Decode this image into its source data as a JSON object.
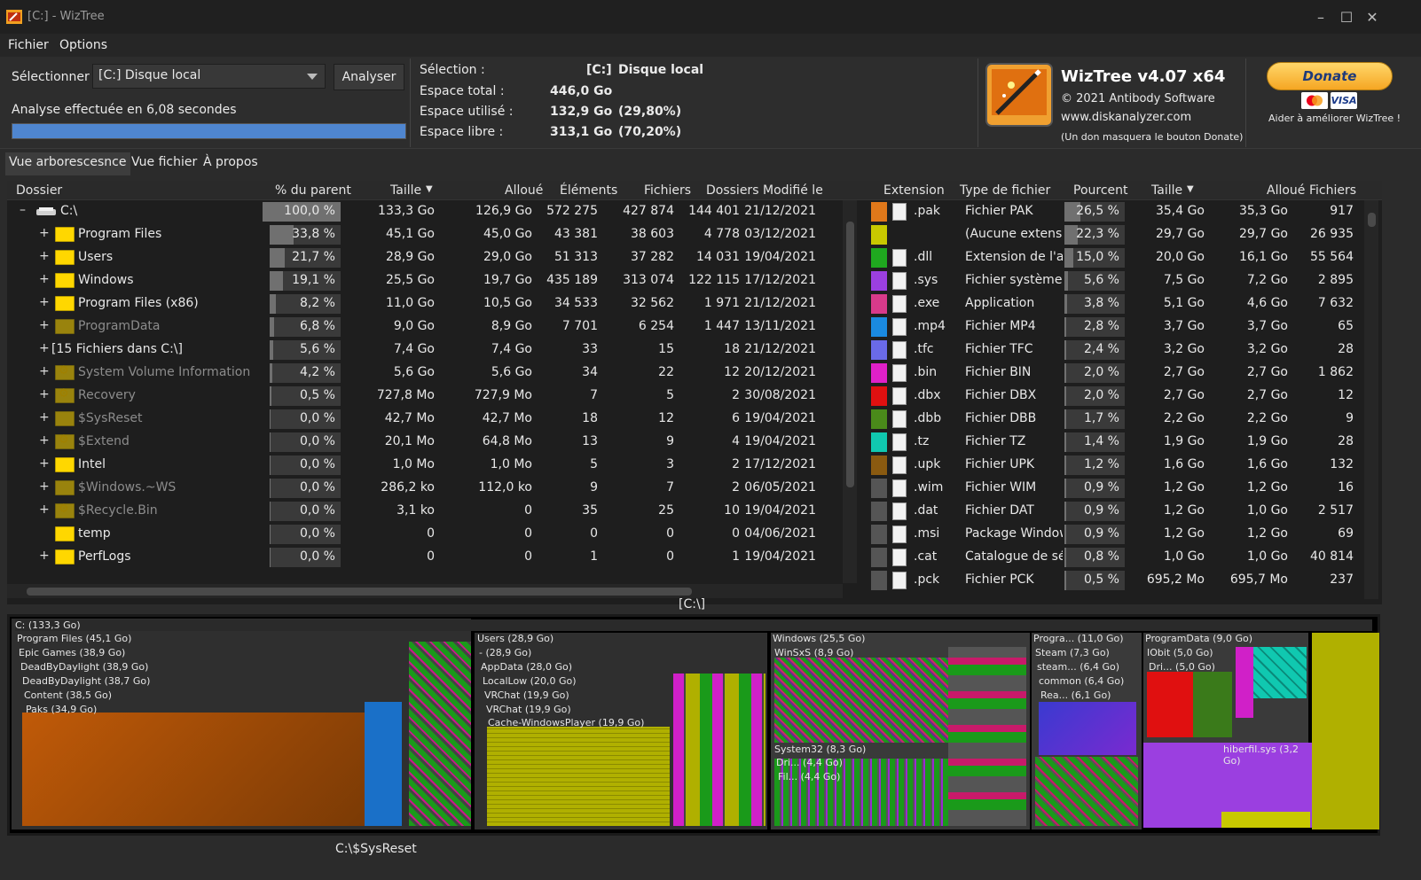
{
  "window": {
    "title": "[C:]  - WizTree",
    "controls": [
      "–",
      "☐",
      "✕"
    ]
  },
  "menu": {
    "file": "Fichier",
    "options": "Options"
  },
  "select_label": "Sélectionner :",
  "drive_value": "[C:] Disque local",
  "analyze_label": "Analyser",
  "analysis_time": "Analyse effectuée en 6,08 secondes",
  "progress": 1.0,
  "selection": {
    "label": "Sélection :",
    "drive": "[C:]",
    "name": "Disque local",
    "total_label": "Espace total :",
    "total": "446,0 Go",
    "used_label": "Espace utilisé :",
    "used": "132,9 Go",
    "used_pct": "(29,80%)",
    "free_label": "Espace libre :",
    "free": "313,1 Go",
    "free_pct": "(70,20%)"
  },
  "about": {
    "name": "WizTree v4.07 x64",
    "copyright": "© 2021 Antibody Software",
    "site": "www.diskanalyzer.com",
    "note": "(Un don masquera le bouton Donate)"
  },
  "donate": {
    "label": "Donate",
    "visa": "VISA",
    "caption": "Aider à améliorer WizTree !"
  },
  "tabs": [
    "Vue arborescesnce",
    "Vue fichier",
    "À propos"
  ],
  "tree": {
    "headers": [
      "Dossier",
      "% du parent",
      "Taille",
      "Alloué",
      "Éléments",
      "Fichiers",
      "Dossiers",
      "Modifié le"
    ],
    "rows": [
      {
        "name": "C:\\",
        "pct": "100,0 %",
        "pctv": 100,
        "size": "133,3 Go",
        "alloc": "126,9 Go",
        "items": "572 275",
        "files": "427 874",
        "dirs": "144 401",
        "date": "21/12/2021",
        "type": "drive",
        "exp": "–"
      },
      {
        "name": "Program Files",
        "pct": "33,8 %",
        "pctv": 33.8,
        "size": "45,1 Go",
        "alloc": "45,0 Go",
        "items": "43 381",
        "files": "38 603",
        "dirs": "4 778",
        "date": "03/12/2021",
        "type": "folder",
        "exp": "+"
      },
      {
        "name": "Users",
        "pct": "21,7 %",
        "pctv": 21.7,
        "size": "28,9 Go",
        "alloc": "29,0 Go",
        "items": "51 313",
        "files": "37 282",
        "dirs": "14 031",
        "date": "19/04/2021",
        "type": "folder",
        "exp": "+"
      },
      {
        "name": "Windows",
        "pct": "19,1 %",
        "pctv": 19.1,
        "size": "25,5 Go",
        "alloc": "19,7 Go",
        "items": "435 189",
        "files": "313 074",
        "dirs": "122 115",
        "date": "17/12/2021",
        "type": "folder",
        "exp": "+"
      },
      {
        "name": "Program Files (x86)",
        "pct": "8,2 %",
        "pctv": 8.2,
        "size": "11,0 Go",
        "alloc": "10,5 Go",
        "items": "34 533",
        "files": "32 562",
        "dirs": "1 971",
        "date": "21/12/2021",
        "type": "folder",
        "exp": "+"
      },
      {
        "name": "ProgramData",
        "pct": "6,8 %",
        "pctv": 6.8,
        "size": "9,0 Go",
        "alloc": "8,9 Go",
        "items": "7 701",
        "files": "6 254",
        "dirs": "1 447",
        "date": "13/11/2021",
        "type": "folder-gray",
        "exp": "+"
      },
      {
        "name": "[15 Fichiers dans C:\\]",
        "pct": "5,6 %",
        "pctv": 5.6,
        "size": "7,4 Go",
        "alloc": "7,4 Go",
        "items": "33",
        "files": "15",
        "dirs": "18",
        "date": "21/12/2021",
        "type": "none",
        "exp": "+"
      },
      {
        "name": "System Volume Information",
        "pct": "4,2 %",
        "pctv": 4.2,
        "size": "5,6 Go",
        "alloc": "5,6 Go",
        "items": "34",
        "files": "22",
        "dirs": "12",
        "date": "20/12/2021",
        "type": "sys",
        "exp": "+"
      },
      {
        "name": "Recovery",
        "pct": "0,5 %",
        "pctv": 0.5,
        "size": "727,8 Mo",
        "alloc": "727,9 Mo",
        "items": "7",
        "files": "5",
        "dirs": "2",
        "date": "30/08/2021",
        "type": "sys",
        "exp": "+"
      },
      {
        "name": "$SysReset",
        "pct": "0,0 %",
        "pctv": 0,
        "size": "42,7 Mo",
        "alloc": "42,7 Mo",
        "items": "18",
        "files": "12",
        "dirs": "6",
        "date": "19/04/2021",
        "type": "folder-gray",
        "exp": "+"
      },
      {
        "name": "$Extend",
        "pct": "0,0 %",
        "pctv": 0,
        "size": "20,1 Mo",
        "alloc": "64,8 Mo",
        "items": "13",
        "files": "9",
        "dirs": "4",
        "date": "19/04/2021",
        "type": "sys",
        "exp": "+"
      },
      {
        "name": "Intel",
        "pct": "0,0 %",
        "pctv": 0,
        "size": "1,0 Mo",
        "alloc": "1,0 Mo",
        "items": "5",
        "files": "3",
        "dirs": "2",
        "date": "17/12/2021",
        "type": "folder",
        "exp": "+"
      },
      {
        "name": "$Windows.~WS",
        "pct": "0,0 %",
        "pctv": 0,
        "size": "286,2 ko",
        "alloc": "112,0 ko",
        "items": "9",
        "files": "7",
        "dirs": "2",
        "date": "06/05/2021",
        "type": "folder-gray",
        "exp": "+"
      },
      {
        "name": "$Recycle.Bin",
        "pct": "0,0 %",
        "pctv": 0,
        "size": "3,1 ko",
        "alloc": "0",
        "items": "35",
        "files": "25",
        "dirs": "10",
        "date": "19/04/2021",
        "type": "sys",
        "exp": "+"
      },
      {
        "name": "temp",
        "pct": "0,0 %",
        "pctv": 0,
        "size": "0",
        "alloc": "0",
        "items": "0",
        "files": "0",
        "dirs": "0",
        "date": "04/06/2021",
        "type": "folder",
        "exp": ""
      },
      {
        "name": "PerfLogs",
        "pct": "0,0 %",
        "pctv": 0,
        "size": "0",
        "alloc": "0",
        "items": "1",
        "files": "0",
        "dirs": "1",
        "date": "19/04/2021",
        "type": "folder",
        "exp": "+"
      }
    ]
  },
  "ext": {
    "headers": [
      "Extension",
      "Type de fichier",
      "Pourcent",
      "Taille",
      "Alloué",
      "Fichiers"
    ],
    "rows": [
      {
        "color": "#e0781a",
        "ext": ".pak",
        "type": "Fichier PAK",
        "pct": "26,5 %",
        "pctv": 26.5,
        "size": "35,4 Go",
        "alloc": "35,3 Go",
        "files": "917"
      },
      {
        "color": "#c8c800",
        "ext": "",
        "type": "(Aucune extensio",
        "pct": "22,3 %",
        "pctv": 22.3,
        "size": "29,7 Go",
        "alloc": "29,7 Go",
        "files": "26 935"
      },
      {
        "color": "#1fa81f",
        "ext": ".dll",
        "type": "Extension de l'ap",
        "pct": "15,0 %",
        "pctv": 15,
        "size": "20,0 Go",
        "alloc": "16,1 Go",
        "files": "55 564"
      },
      {
        "color": "#9b3fe0",
        "ext": ".sys",
        "type": "Fichier système",
        "pct": "5,6 %",
        "pctv": 5.6,
        "size": "7,5 Go",
        "alloc": "7,2 Go",
        "files": "2 895"
      },
      {
        "color": "#d83a8a",
        "ext": ".exe",
        "type": "Application",
        "pct": "3,8 %",
        "pctv": 3.8,
        "size": "5,1 Go",
        "alloc": "4,6 Go",
        "files": "7 632"
      },
      {
        "color": "#1a8ae0",
        "ext": ".mp4",
        "type": "Fichier MP4",
        "pct": "2,8 %",
        "pctv": 2.8,
        "size": "3,7 Go",
        "alloc": "3,7 Go",
        "files": "65"
      },
      {
        "color": "#6a6ae8",
        "ext": ".tfc",
        "type": "Fichier TFC",
        "pct": "2,4 %",
        "pctv": 2.4,
        "size": "3,2 Go",
        "alloc": "3,2 Go",
        "files": "28"
      },
      {
        "color": "#e020c8",
        "ext": ".bin",
        "type": "Fichier BIN",
        "pct": "2,0 %",
        "pctv": 2,
        "size": "2,7 Go",
        "alloc": "2,7 Go",
        "files": "1 862"
      },
      {
        "color": "#e01010",
        "ext": ".dbx",
        "type": "Fichier DBX",
        "pct": "2,0 %",
        "pctv": 2,
        "size": "2,7 Go",
        "alloc": "2,7 Go",
        "files": "12"
      },
      {
        "color": "#4a8a1a",
        "ext": ".dbb",
        "type": "Fichier DBB",
        "pct": "1,7 %",
        "pctv": 1.7,
        "size": "2,2 Go",
        "alloc": "2,2 Go",
        "files": "9"
      },
      {
        "color": "#10c8b0",
        "ext": ".tz",
        "type": "Fichier TZ",
        "pct": "1,4 %",
        "pctv": 1.4,
        "size": "1,9 Go",
        "alloc": "1,9 Go",
        "files": "28"
      },
      {
        "color": "#8a5a10",
        "ext": ".upk",
        "type": "Fichier UPK",
        "pct": "1,2 %",
        "pctv": 1.2,
        "size": "1,6 Go",
        "alloc": "1,6 Go",
        "files": "132"
      },
      {
        "color": "#555555",
        "ext": ".wim",
        "type": "Fichier WIM",
        "pct": "0,9 %",
        "pctv": 0.9,
        "size": "1,2 Go",
        "alloc": "1,2 Go",
        "files": "16"
      },
      {
        "color": "#555555",
        "ext": ".dat",
        "type": "Fichier DAT",
        "pct": "0,9 %",
        "pctv": 0.9,
        "size": "1,2 Go",
        "alloc": "1,0 Go",
        "files": "2 517"
      },
      {
        "color": "#555555",
        "ext": ".msi",
        "type": "Package Window",
        "pct": "0,9 %",
        "pctv": 0.9,
        "size": "1,2 Go",
        "alloc": "1,2 Go",
        "files": "69"
      },
      {
        "color": "#555555",
        "ext": ".cat",
        "type": "Catalogue de sé",
        "pct": "0,8 %",
        "pctv": 0.8,
        "size": "1,0 Go",
        "alloc": "1,0 Go",
        "files": "40 814"
      },
      {
        "color": "#555555",
        "ext": ".pck",
        "type": "Fichier PCK",
        "pct": "0,5 %",
        "pctv": 0.5,
        "size": "695,2 Mo",
        "alloc": "695,7 Mo",
        "files": "237"
      }
    ]
  },
  "path_label": "[C:\\]",
  "treemap_labels": {
    "root": "C: (133,3 Go)",
    "pf": "Program Files (45,1 Go)",
    "epic": "Epic Games (38,9 Go)",
    "dbd1": "DeadByDaylight (38,9 Go)",
    "dbd2": "DeadByDaylight (38,7 Go)",
    "content": "Content (38,5 Go)",
    "paks": "Paks (34,9 Go)",
    "users": "Users (28,9 Go)",
    "dash": "- (28,9 Go)",
    "appdata": "AppData (28,0 Go)",
    "locallow": "LocalLow (20,0 Go)",
    "vrchat1": "VRChat (19,9 Go)",
    "vrchat2": "VRChat (19,9 Go)",
    "cache": "Cache-WindowsPlayer (19,9 Go)",
    "windows": "Windows (25,5 Go)",
    "winsxs": "WinSxS (8,9 Go)",
    "system32": "System32 (8,3 Go)",
    "dri": "Dri... (4,4 Go)",
    "fil": "Fil... (4,4 Go)",
    "progra": "Progra... (11,0 Go)",
    "steam": "Steam (7,3 Go)",
    "steamdots": "steam... (6,4 Go)",
    "common": "common (6,4 Go)",
    "rea": "Rea... (6,1 Go)",
    "programdata": "ProgramData (9,0 Go)",
    "iobit": "IObit (5,0 Go)",
    "dri2": "Dri... (5,0 Go)",
    "hiberfil": "hiberfil.sys (3,2 Go)"
  },
  "status": "C:\\$SysReset"
}
